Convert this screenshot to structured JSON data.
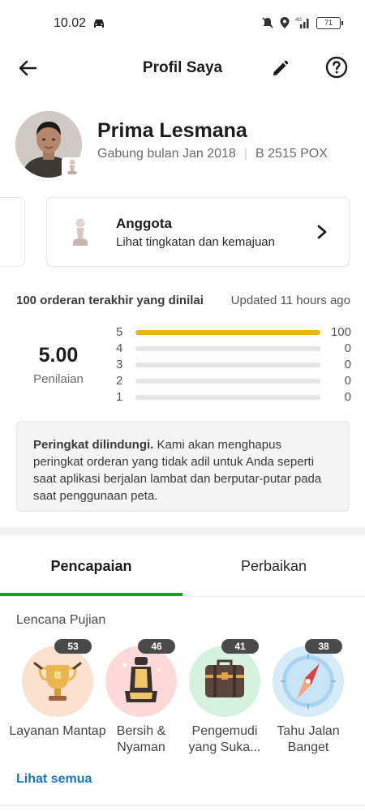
{
  "status_bar": {
    "time": "10.02",
    "battery": "71",
    "network": "4G"
  },
  "header": {
    "title": "Profil Saya"
  },
  "profile": {
    "name": "Prima Lesmana",
    "joined": "Gabung bulan Jan 2018",
    "separator": "|",
    "plate": "B 2515 POX"
  },
  "tier": {
    "title": "Anggota",
    "subtitle": "Lihat tingkatan dan kemajuan"
  },
  "ratings": {
    "title": "100 orderan terakhir yang dinilai",
    "updated": "Updated 11 hours ago",
    "score": "5.00",
    "score_label": "Penilaian",
    "rows": [
      {
        "star": "5",
        "count": "100",
        "fraction": 1.0
      },
      {
        "star": "4",
        "count": "0",
        "fraction": 0
      },
      {
        "star": "3",
        "count": "0",
        "fraction": 0
      },
      {
        "star": "2",
        "count": "0",
        "fraction": 0
      },
      {
        "star": "1",
        "count": "0",
        "fraction": 0
      }
    ]
  },
  "info": {
    "bold": "Peringkat dilindungi.",
    "text": " Kami akan menghapus peringkat orderan yang tidak adil untuk Anda seperti saat aplikasi berjalan lambat dan berputar-putar pada saat penggunaan peta."
  },
  "tabs": {
    "active": "Pencapaian",
    "inactive": "Perbaikan"
  },
  "badges": {
    "title": "Lencana Pujian",
    "items": [
      {
        "count": "53",
        "label": "Layanan Mantap",
        "color": "#fde1cf",
        "icon": "trophy-icon"
      },
      {
        "count": "46",
        "label": "Bersih & Nyaman",
        "color": "#fdd9d9",
        "icon": "car-seat-icon"
      },
      {
        "count": "41",
        "label": "Pengemudi yang Suka...",
        "color": "#d5f2df",
        "icon": "suitcase-icon"
      },
      {
        "count": "38",
        "label": "Tahu Jalan Banget",
        "color": "#d6ecf8",
        "icon": "compass-icon"
      }
    ],
    "see_all": "Lihat semua"
  },
  "colors": {
    "accent_green": "#00aa13",
    "rating_bar": "#f0b411",
    "link_blue": "#1676c8"
  }
}
